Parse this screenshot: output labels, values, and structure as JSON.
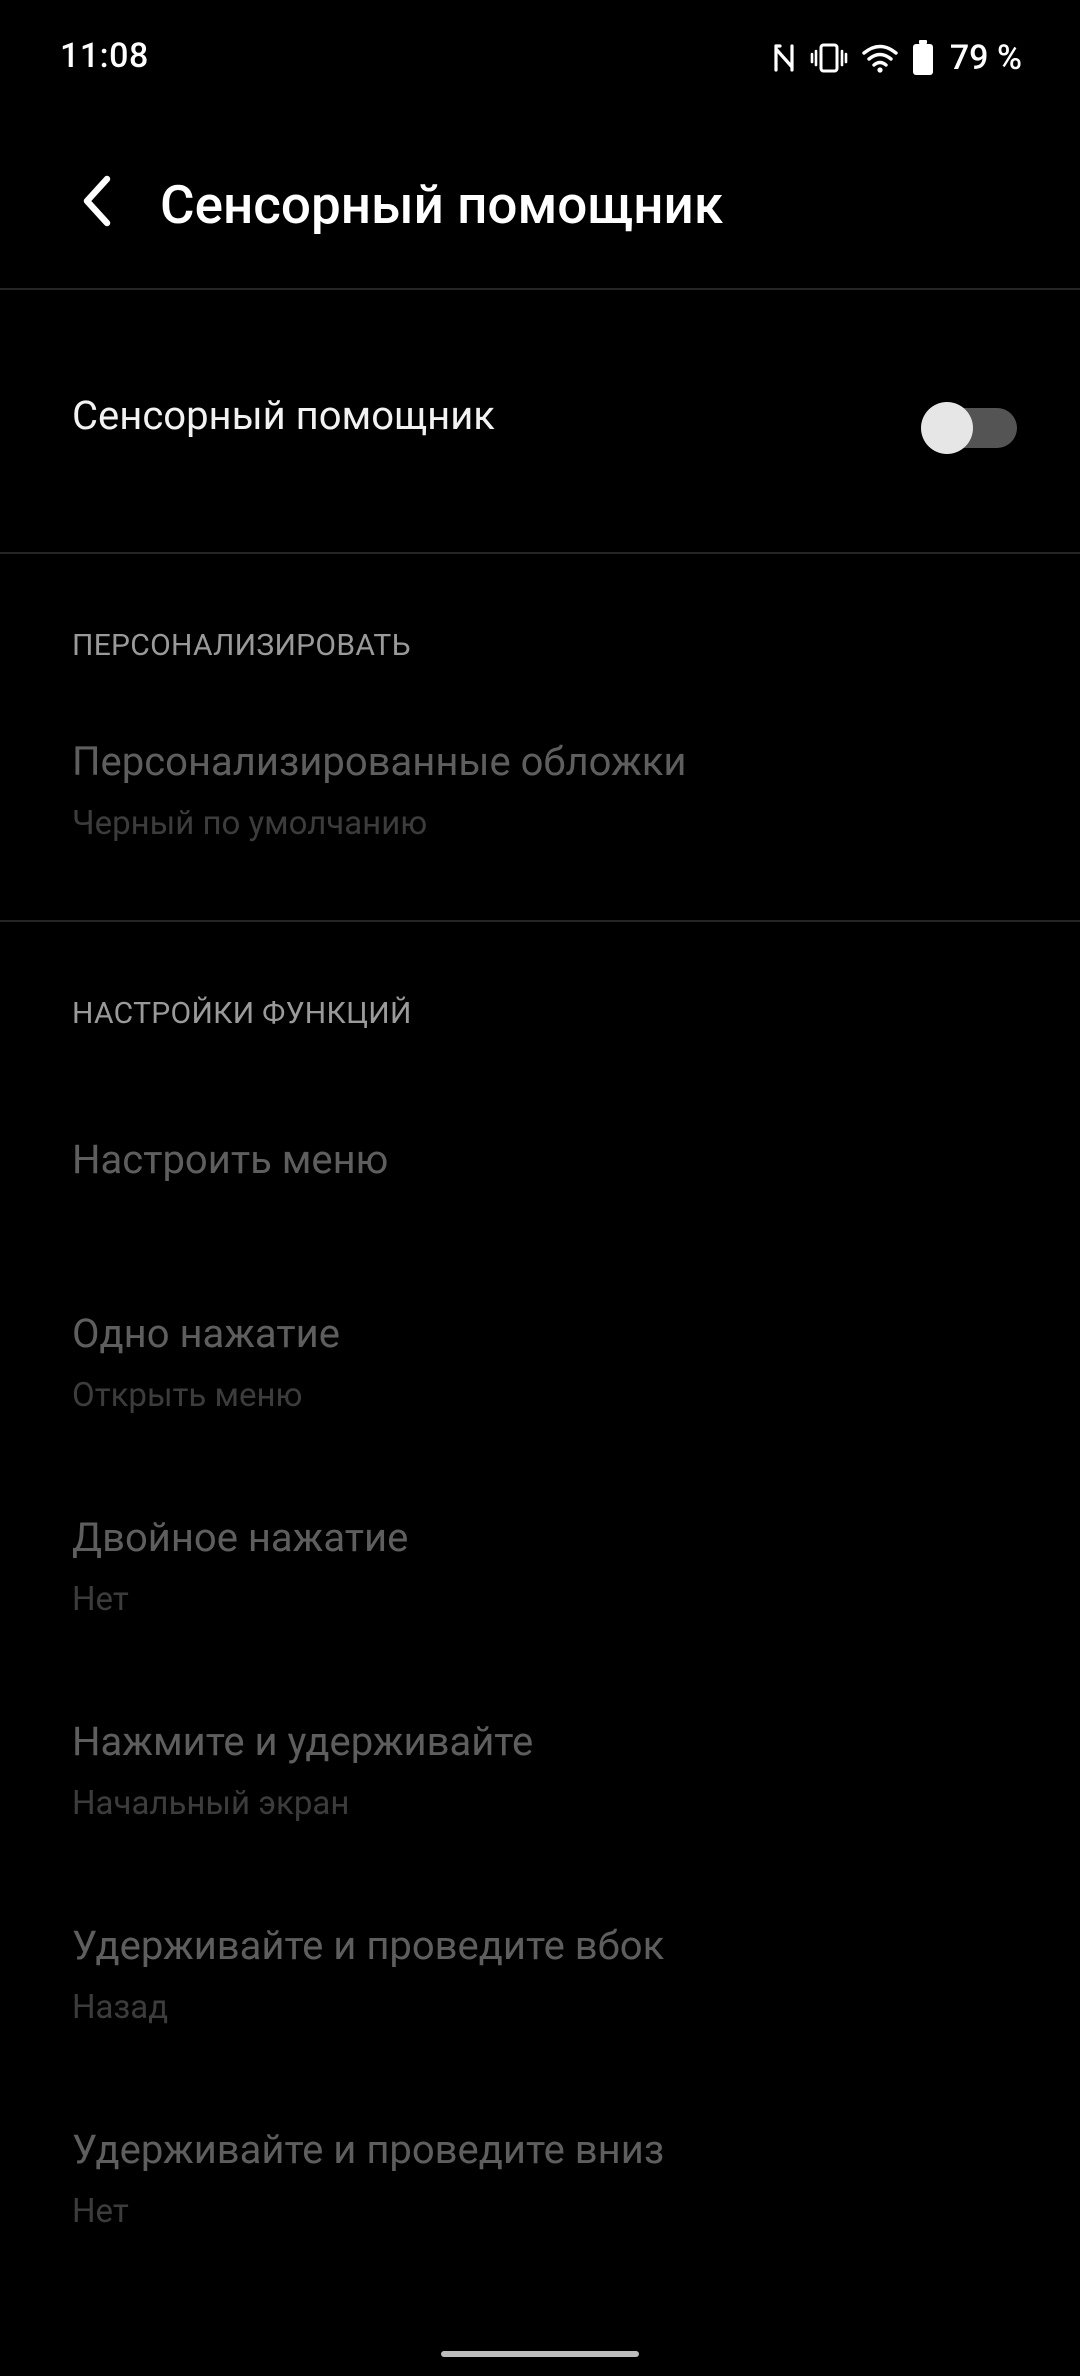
{
  "status_bar": {
    "time": "11:08",
    "battery_percent": "79 %",
    "icons": [
      "nfc-icon",
      "vibrate-icon",
      "wifi-icon",
      "battery-icon"
    ]
  },
  "app_bar": {
    "back_icon": "back-arrow-icon",
    "title": "Сенсорный помощник"
  },
  "master_toggle": {
    "label": "Сенсорный помощник",
    "enabled": false
  },
  "sections": {
    "personalize": {
      "header": "ПЕРСОНАЛИЗИРОВАТЬ",
      "items": [
        {
          "title": "Персонализированные обложки",
          "summary": "Черный по умолчанию"
        }
      ]
    },
    "function_settings": {
      "header": "НАСТРОЙКИ ФУНКЦИЙ",
      "items": [
        {
          "title": "Настроить меню",
          "summary": ""
        },
        {
          "title": "Одно нажатие",
          "summary": "Открыть меню"
        },
        {
          "title": "Двойное нажатие",
          "summary": "Нет"
        },
        {
          "title": "Нажмите и удерживайте",
          "summary": "Начальный экран"
        },
        {
          "title": "Удерживайте и проведите вбок",
          "summary": "Назад"
        },
        {
          "title": "Удерживайте и проведите вниз",
          "summary": "Нет"
        }
      ]
    }
  },
  "colors": {
    "background": "#000000",
    "title_text": "#ffffff",
    "disabled_title": "#5e5e5e",
    "disabled_summary": "#3c3c3c",
    "section_header": "#9a9a9a",
    "divider": "#262626"
  }
}
